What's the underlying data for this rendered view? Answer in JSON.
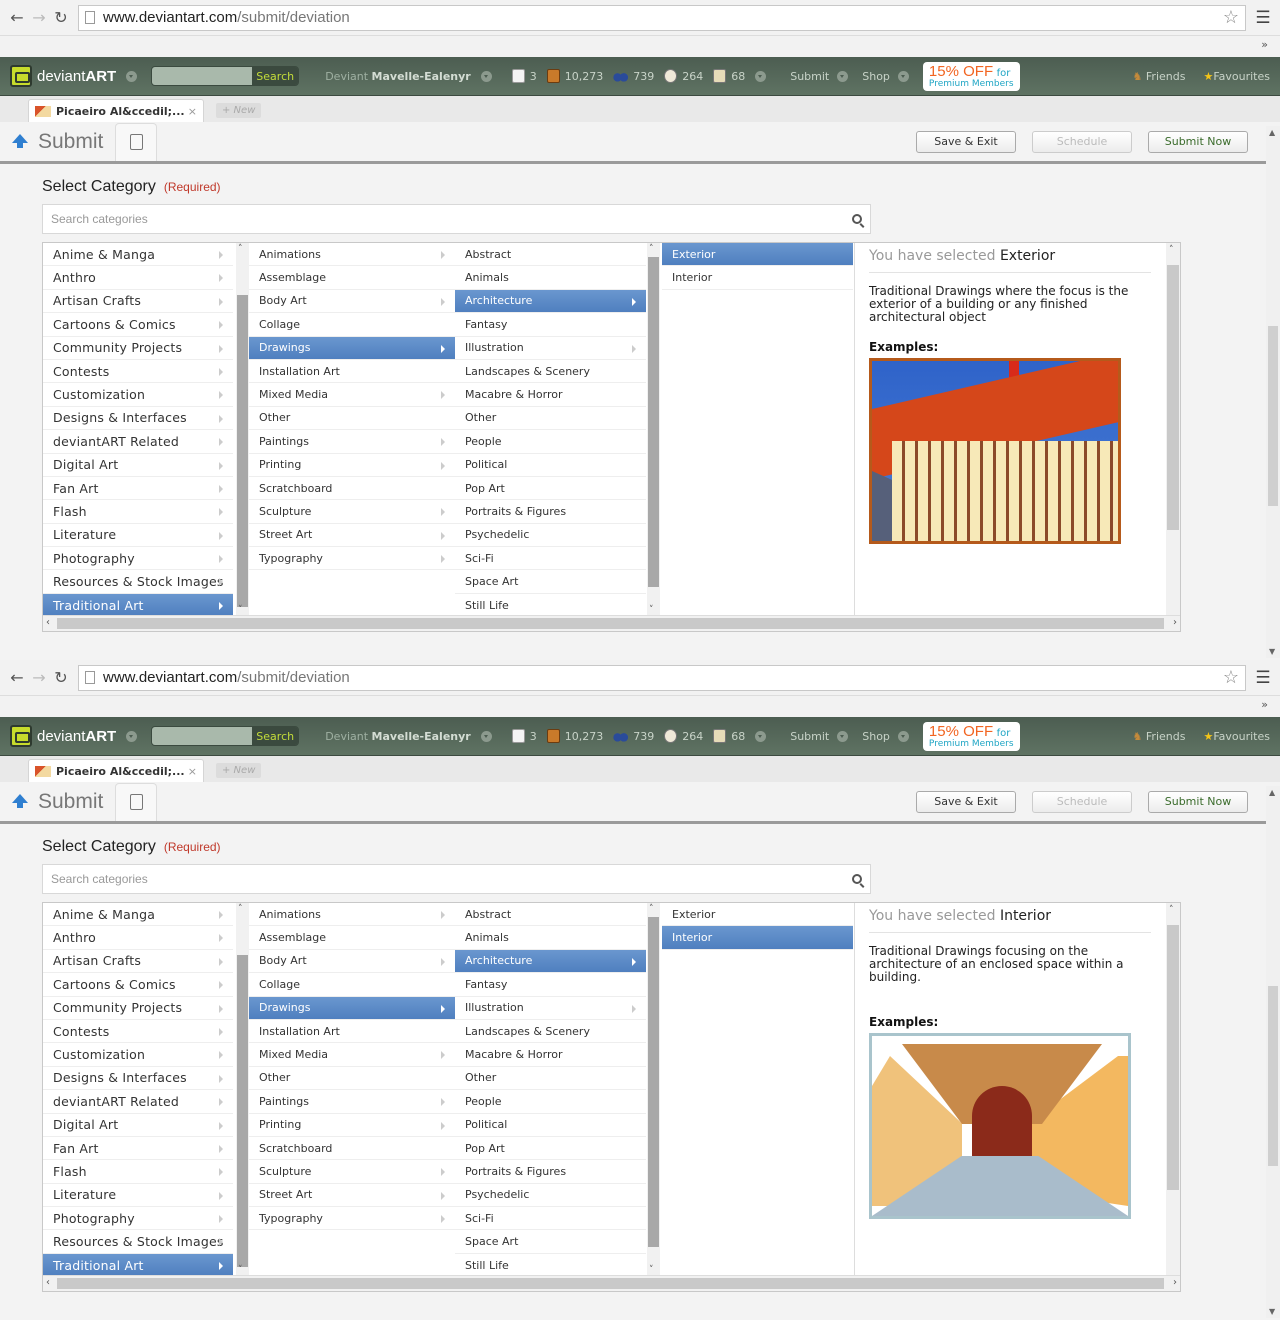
{
  "browser": {
    "url_host": "www.deviantart.com",
    "url_path": "/submit/deviation",
    "bookmarks_overflow": "»"
  },
  "header": {
    "logo": {
      "text_light": "deviant",
      "text_bold": "ART"
    },
    "search_button": "Search",
    "user_prefix": "Deviant",
    "username": "Mavelle-Ealenyr",
    "stats": [
      {
        "icon": "notes-icon",
        "value": "3"
      },
      {
        "icon": "deviations-icon",
        "value": "10,273"
      },
      {
        "icon": "watchers-icon",
        "value": "739"
      },
      {
        "icon": "comments-icon",
        "value": "264"
      },
      {
        "icon": "messages-icon",
        "value": "68"
      }
    ],
    "links": [
      "Submit",
      "Shop"
    ],
    "promo": {
      "big": "15% OFF",
      "for": "for",
      "sub": "Premium Members"
    },
    "right_links": [
      "Friends",
      "Favourites"
    ]
  },
  "doc_tabs": {
    "active": "Picaeiro Al&ccedil;...",
    "close": "×",
    "new": "+ New"
  },
  "submit_bar": {
    "title": "Submit",
    "buttons": [
      "Save & Exit",
      "Schedule",
      "Submit Now"
    ]
  },
  "category": {
    "title": "Select Category",
    "required": "(Required)",
    "search_placeholder": "Search categories",
    "col1": [
      {
        "label": "Anime & Manga",
        "sub": true
      },
      {
        "label": "Anthro",
        "sub": true
      },
      {
        "label": "Artisan Crafts",
        "sub": true
      },
      {
        "label": "Cartoons & Comics",
        "sub": true
      },
      {
        "label": "Community Projects",
        "sub": true
      },
      {
        "label": "Contests",
        "sub": true
      },
      {
        "label": "Customization",
        "sub": true
      },
      {
        "label": "Designs & Interfaces",
        "sub": true
      },
      {
        "label": "deviantART Related",
        "sub": true
      },
      {
        "label": "Digital Art",
        "sub": true
      },
      {
        "label": "Fan Art",
        "sub": true
      },
      {
        "label": "Flash",
        "sub": true
      },
      {
        "label": "Literature",
        "sub": true
      },
      {
        "label": "Photography",
        "sub": true
      },
      {
        "label": "Resources & Stock Images",
        "sub": true
      },
      {
        "label": "Traditional Art",
        "sub": true,
        "selected": true
      }
    ],
    "col2": [
      {
        "label": "Animations",
        "sub": true
      },
      {
        "label": "Assemblage",
        "sub": false
      },
      {
        "label": "Body Art",
        "sub": true
      },
      {
        "label": "Collage",
        "sub": false
      },
      {
        "label": "Drawings",
        "sub": true,
        "selected": true
      },
      {
        "label": "Installation Art",
        "sub": false
      },
      {
        "label": "Mixed Media",
        "sub": true
      },
      {
        "label": "Other",
        "sub": false
      },
      {
        "label": "Paintings",
        "sub": true
      },
      {
        "label": "Printing",
        "sub": true
      },
      {
        "label": "Scratchboard",
        "sub": false
      },
      {
        "label": "Sculpture",
        "sub": true
      },
      {
        "label": "Street Art",
        "sub": true
      },
      {
        "label": "Typography",
        "sub": true
      }
    ],
    "col3": [
      {
        "label": "Abstract",
        "sub": false
      },
      {
        "label": "Animals",
        "sub": false
      },
      {
        "label": "Architecture",
        "sub": true,
        "selected": true
      },
      {
        "label": "Fantasy",
        "sub": false
      },
      {
        "label": "Illustration",
        "sub": true
      },
      {
        "label": "Landscapes & Scenery",
        "sub": false
      },
      {
        "label": "Macabre & Horror",
        "sub": false
      },
      {
        "label": "Other",
        "sub": false
      },
      {
        "label": "People",
        "sub": false
      },
      {
        "label": "Political",
        "sub": false
      },
      {
        "label": "Pop Art",
        "sub": false
      },
      {
        "label": "Portraits & Figures",
        "sub": false
      },
      {
        "label": "Psychedelic",
        "sub": false
      },
      {
        "label": "Sci-Fi",
        "sub": false
      },
      {
        "label": "Space Art",
        "sub": false
      },
      {
        "label": "Still Life",
        "sub": false
      }
    ],
    "col4": [
      "Exterior",
      "Interior"
    ],
    "detail_prefix": "You have selected",
    "examples_label": "Examples:"
  },
  "frames": [
    {
      "selected_leaf": "Exterior",
      "description": "Traditional Drawings where the focus is the exterior of a building or any finished architectural object",
      "example": "exterior-drawing"
    },
    {
      "selected_leaf": "Interior",
      "description": "Traditional Drawings focusing on the architecture of an enclosed space within a building.",
      "example": "interior-drawing"
    }
  ]
}
